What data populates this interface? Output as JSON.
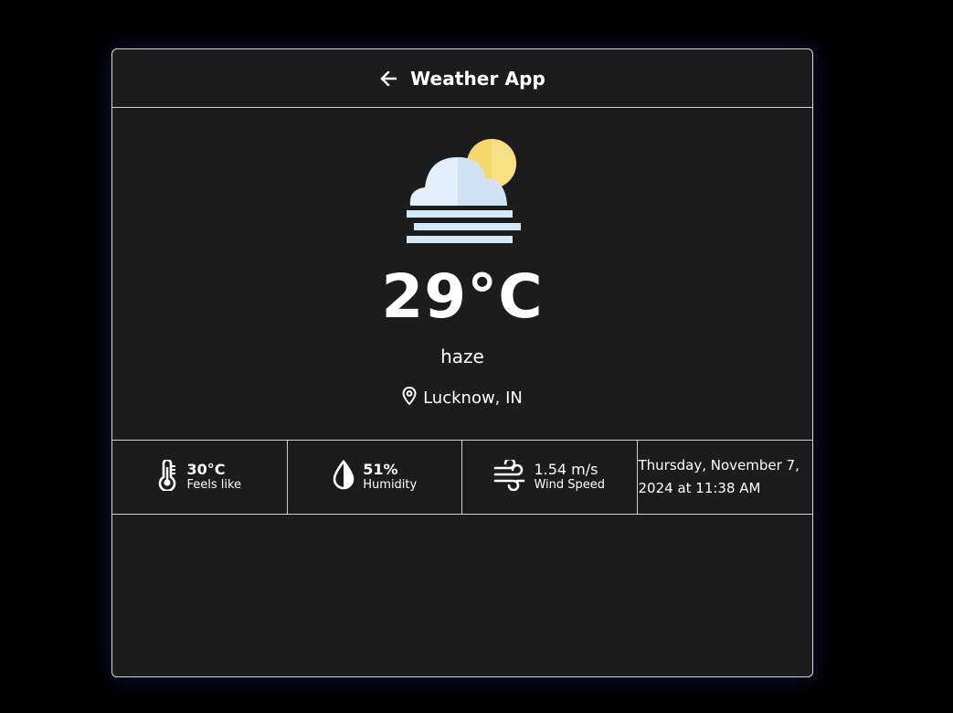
{
  "header": {
    "title": "Weather App",
    "back_icon": "arrow-left-icon"
  },
  "current": {
    "icon": "haze-icon",
    "temperature": "29°C",
    "condition": "haze",
    "location": "Lucknow, IN",
    "location_icon": "map-pin-icon"
  },
  "stats": {
    "feels_like": {
      "value": "30°C",
      "label": "Feels like",
      "icon": "thermometer-icon"
    },
    "humidity": {
      "value": "51%",
      "label": "Humidity",
      "icon": "water-drop-icon"
    },
    "wind": {
      "value": "1.54 m/s",
      "label": "Wind Speed",
      "icon": "wind-icon"
    },
    "datetime": "Thursday, November 7, 2024 at 11:38 AM"
  },
  "colors": {
    "background": "#000000",
    "card": "#1c1c1c",
    "border": "#cfcfcf",
    "sun": "#f5d76e",
    "cloud": "#e3f0fb",
    "haze_lines": "#cfe3f4"
  }
}
